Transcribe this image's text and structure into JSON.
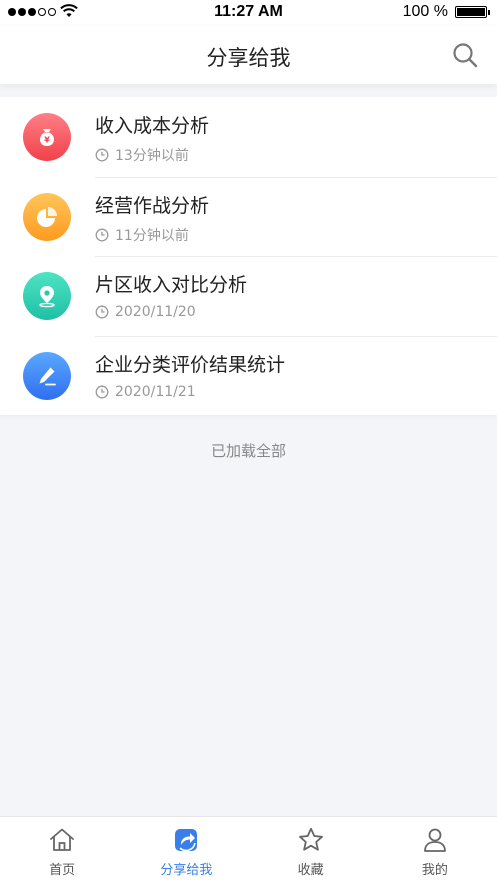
{
  "status_bar": {
    "time": "11:27 AM",
    "battery_text": "100 %"
  },
  "nav": {
    "title": "分享给我",
    "search_icon": "search-icon"
  },
  "items": [
    {
      "title": "收入成本分析",
      "meta": "13分钟以前",
      "icon": "money-bag-icon",
      "color_top": "#ff7f86",
      "color_bottom": "#f0414a"
    },
    {
      "title": "经营作战分析",
      "meta": "11分钟以前",
      "icon": "pie-chart-icon",
      "color_top": "#ffc65a",
      "color_bottom": "#ff9a1f"
    },
    {
      "title": "片区收入对比分析",
      "meta": "2020/11/20",
      "icon": "location-pin-icon",
      "color_top": "#4fe3c3",
      "color_bottom": "#1fc0a6"
    },
    {
      "title": "企业分类评价结果统计",
      "meta": "2020/11/21",
      "icon": "edit-pen-icon",
      "color_top": "#5aa8ff",
      "color_bottom": "#2f6ff0"
    }
  ],
  "footer_text": "已加载全部",
  "tabs": [
    {
      "label": "首页",
      "icon": "home-icon",
      "active": false
    },
    {
      "label": "分享给我",
      "icon": "share-icon",
      "active": true
    },
    {
      "label": "收藏",
      "icon": "star-icon",
      "active": false
    },
    {
      "label": "我的",
      "icon": "user-icon",
      "active": false
    }
  ],
  "colors": {
    "accent": "#3a7ee8",
    "background": "#f4f5f8"
  }
}
